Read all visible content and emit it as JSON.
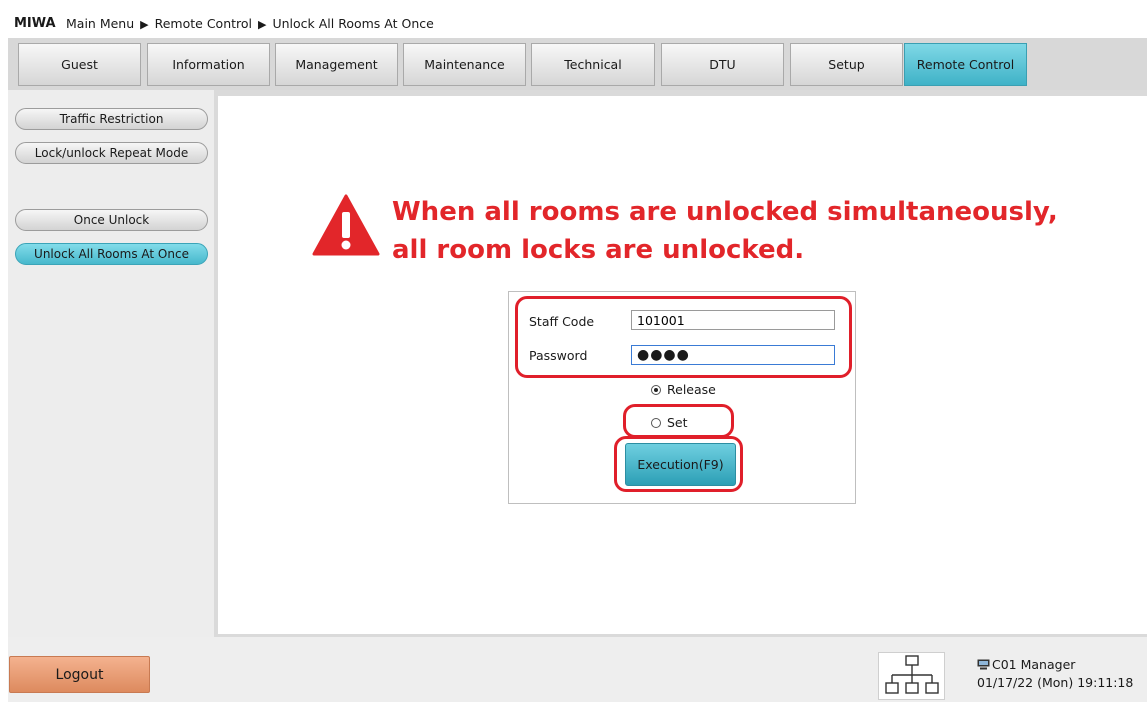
{
  "header": {
    "brand": "MIWA",
    "breadcrumb": [
      "Main Menu",
      "Remote Control",
      "Unlock All Rooms At Once"
    ],
    "separator_icon": "triangle-right-icon"
  },
  "tabs": [
    {
      "label": "Guest",
      "active": false
    },
    {
      "label": "Information",
      "active": false
    },
    {
      "label": "Management",
      "active": false
    },
    {
      "label": "Maintenance",
      "active": false
    },
    {
      "label": "Technical",
      "active": false
    },
    {
      "label": "DTU",
      "active": false
    },
    {
      "label": "Setup",
      "active": false
    },
    {
      "label": "Remote Control",
      "active": true
    }
  ],
  "sidebar": {
    "items": [
      {
        "label": "Traffic Restriction",
        "active": false
      },
      {
        "label": "Lock/unlock Repeat Mode",
        "active": false
      },
      {
        "label": "Once Unlock",
        "active": false
      },
      {
        "label": "Unlock All Rooms At Once",
        "active": true
      }
    ]
  },
  "warning": {
    "icon": "warning-triangle-icon",
    "line1": "When all rooms are unlocked simultaneously,",
    "line2": "all room locks are unlocked."
  },
  "form": {
    "staff_code_label": "Staff Code",
    "staff_code_value": "101001",
    "password_label": "Password",
    "password_value": "●●●●",
    "options": [
      {
        "label": "Release",
        "selected": true
      },
      {
        "label": "Set",
        "selected": false
      }
    ],
    "execute_label": "Execution(F9)"
  },
  "footer": {
    "logout_label": "Logout",
    "network_icon": "network-icon",
    "terminal_icon": "computer-icon",
    "user": "C01 Manager",
    "datetime": "01/17/22 (Mon) 19:11:18"
  },
  "colors": {
    "accent": "#47b8cc",
    "warning": "#e2262a",
    "highlight": "#e01f2a",
    "logout": "#dd8a5e"
  }
}
